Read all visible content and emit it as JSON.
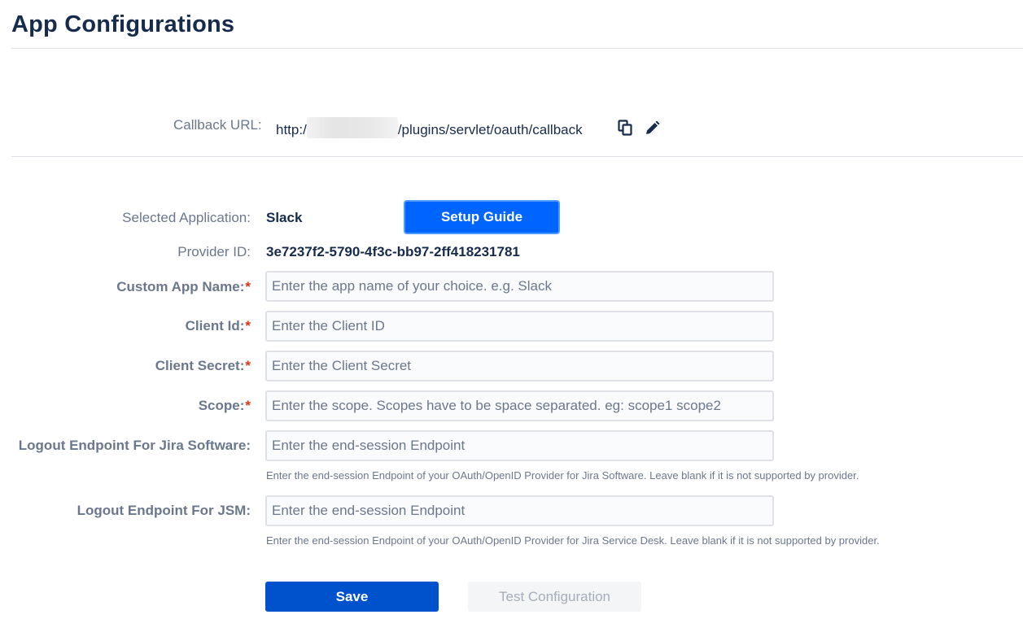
{
  "page": {
    "title": "App Configurations"
  },
  "callback": {
    "label": "Callback URL:",
    "url_prefix": "http:/",
    "url_suffix": "/plugins/servlet/oauth/callback"
  },
  "setup_guide_label": "Setup Guide",
  "fields": {
    "selected_application": {
      "label": "Selected Application:",
      "value": "Slack"
    },
    "provider_id": {
      "label": "Provider ID:",
      "value": "3e7237f2-5790-4f3c-bb97-2ff418231781"
    },
    "custom_app_name": {
      "label": "Custom App Name:",
      "required": "*",
      "value": "",
      "placeholder": "Enter the app name of your choice. e.g. Slack"
    },
    "client_id": {
      "label": "Client Id:",
      "required": "*",
      "value": "",
      "placeholder": "Enter the Client ID"
    },
    "client_secret": {
      "label": "Client Secret:",
      "required": "*",
      "value": "",
      "placeholder": "Enter the Client Secret"
    },
    "scope": {
      "label": "Scope:",
      "required": "*",
      "value": "",
      "placeholder": "Enter the scope. Scopes have to be space separated. eg: scope1 scope2"
    },
    "logout_jira": {
      "label": "Logout Endpoint For Jira Software:",
      "value": "",
      "placeholder": "Enter the end-session Endpoint",
      "help": "Enter the end-session Endpoint of your OAuth/OpenID Provider for Jira Software. Leave blank if it is not supported by provider."
    },
    "logout_jsm": {
      "label": "Logout Endpoint For JSM:",
      "value": "",
      "placeholder": "Enter the end-session Endpoint",
      "help": "Enter the end-session Endpoint of your OAuth/OpenID Provider for Jira Service Desk. Leave blank if it is not supported by provider."
    }
  },
  "buttons": {
    "save": "Save",
    "test": "Test Configuration"
  },
  "icons": {
    "copy": "copy-icon",
    "edit": "pencil-icon"
  },
  "colors": {
    "primary": "#0052cc",
    "setup_guide": "#0065ff",
    "required": "#de350b",
    "label": "#6b778c",
    "text": "#172b4d"
  }
}
